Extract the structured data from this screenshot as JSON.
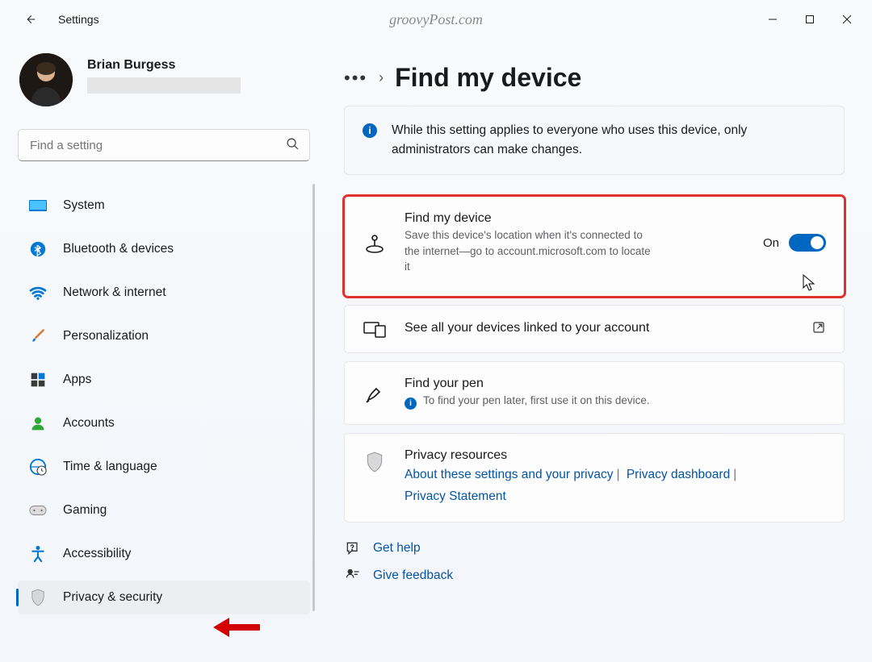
{
  "watermark": "groovyPost.com",
  "header": {
    "title": "Settings"
  },
  "account": {
    "name": "Brian Burgess"
  },
  "search": {
    "placeholder": "Find a setting"
  },
  "nav": [
    {
      "key": "system",
      "label": "System"
    },
    {
      "key": "bluetooth",
      "label": "Bluetooth & devices"
    },
    {
      "key": "network",
      "label": "Network & internet"
    },
    {
      "key": "personalization",
      "label": "Personalization"
    },
    {
      "key": "apps",
      "label": "Apps"
    },
    {
      "key": "accounts",
      "label": "Accounts"
    },
    {
      "key": "time",
      "label": "Time & language"
    },
    {
      "key": "gaming",
      "label": "Gaming"
    },
    {
      "key": "accessibility",
      "label": "Accessibility"
    },
    {
      "key": "privacy",
      "label": "Privacy & security",
      "selected": true
    }
  ],
  "page": {
    "title": "Find my device",
    "banner": "While this setting applies to everyone who uses this device, only administrators can make changes.",
    "find_device": {
      "title": "Find my device",
      "sub": "Save this device's location when it's connected to the internet—go to account.microsoft.com to locate it",
      "state": "On"
    },
    "linked": {
      "title": "See all your devices linked to your account"
    },
    "pen": {
      "title": "Find your pen",
      "sub": "To find your pen later, first use it on this device."
    },
    "privacy": {
      "title": "Privacy resources",
      "link1": "About these settings and your privacy",
      "link2": "Privacy dashboard",
      "link3": "Privacy Statement"
    },
    "help": "Get help",
    "feedback": "Give feedback"
  }
}
